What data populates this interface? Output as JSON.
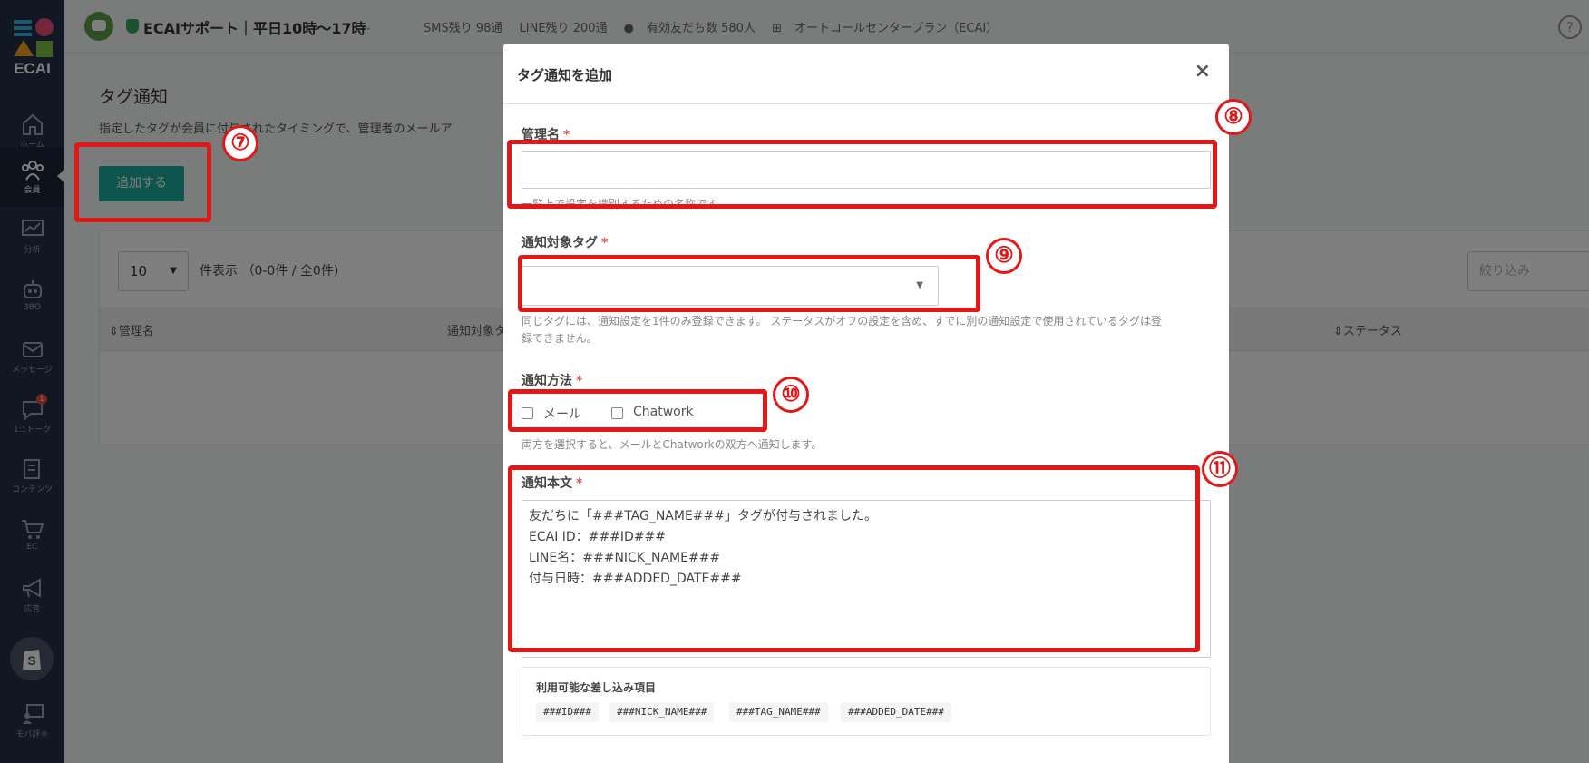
{
  "sidebar": {
    "logo_text": "ECAI",
    "items": [
      {
        "label": "ホーム",
        "icon": "home-icon"
      },
      {
        "label": "会員",
        "icon": "members-icon",
        "active": true
      },
      {
        "label": "分析",
        "icon": "analytics-icon"
      },
      {
        "label": "3BO",
        "icon": "robot-icon"
      },
      {
        "label": "メッセージ",
        "icon": "message-icon"
      },
      {
        "label": "1:1トーク",
        "icon": "chat-icon",
        "badge": "1"
      },
      {
        "label": "コンテンツ",
        "icon": "content-icon"
      },
      {
        "label": "EC",
        "icon": "cart-icon"
      },
      {
        "label": "広告",
        "icon": "megaphone-icon"
      },
      {
        "label": "",
        "icon": "shopify-icon"
      },
      {
        "label": "モバ評®",
        "icon": "review-icon"
      }
    ]
  },
  "topbar": {
    "account_name": "ECAIサポート｜平日10時〜17時",
    "sms_remaining": "SMS残り 98通",
    "line_remaining": "LINE残り 200通",
    "active_friends": "有効友だち数 580人",
    "plan": "オートコールセンタープラン（ECAI）",
    "help": "?"
  },
  "page": {
    "title": "タグ通知",
    "description": "指定したタグが会員に付与されたタイミングで、管理者のメールア",
    "add_button": "追加する",
    "page_length": "10",
    "count_text": "件表示 （0-0件 / 全0件)",
    "search_placeholder": "絞り込み",
    "columns": [
      "管理名",
      "通知対象タ",
      "ステータス"
    ]
  },
  "modal": {
    "title": "タグ通知を追加",
    "close": "×",
    "name_label": "管理名",
    "name_help": "一覧上で設定を識別するための名称です。",
    "tag_label": "通知対象タグ",
    "tag_help_1": "同じタグには、通知設定を1件のみ登録できます。 ステータスがオフの設定を含め、すでに別の通知設定で使用されているタグは登",
    "tag_help_2": "録できません。",
    "method_label": "通知方法",
    "method_options": [
      "メール",
      "Chatwork"
    ],
    "method_help": "両方を選択すると、メールとChatworkの双方へ通知します。",
    "body_label": "通知本文",
    "body_text": "友だちに「###TAG_NAME###」タグが付与されました。\nECAI ID：###ID###\nLINE名：###NICK_NAME###\n付与日時：###ADDED_DATE###",
    "vars_title": "利用可能な差し込み項目",
    "vars": [
      "###ID###",
      "###NICK_NAME###",
      "###TAG_NAME###",
      "###ADDED_DATE###"
    ],
    "required_mark": "*"
  },
  "annotations": [
    "⑦",
    "⑧",
    "⑨",
    "⑩",
    "⑪"
  ],
  "colors": {
    "sidebar": "#223049",
    "accent": "#1aab9b",
    "annotation": "#e01818"
  }
}
